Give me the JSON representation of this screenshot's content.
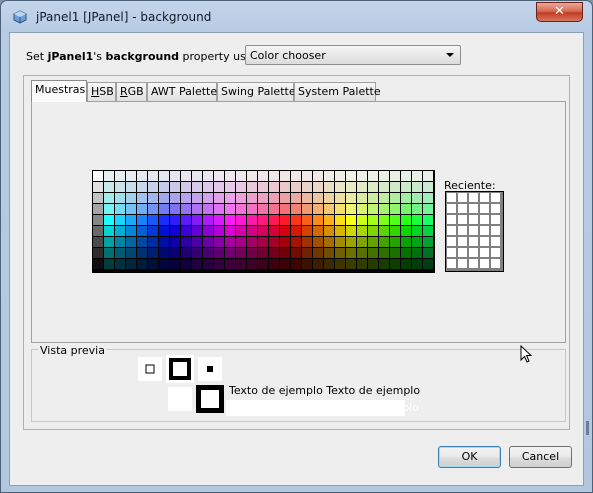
{
  "window": {
    "title": "jPanel1 [JPanel] - background",
    "close_label": "✕"
  },
  "set_property": {
    "prefix": "Set ",
    "component": "jPanel1",
    "middle1": "'s ",
    "property": "background",
    "suffix": " property using:"
  },
  "combo": {
    "value": "Color chooser"
  },
  "tabs": [
    {
      "label": "Muestras",
      "active": true
    },
    {
      "label": "HSB",
      "underline": "H",
      "rest": "SB"
    },
    {
      "label": "RGB",
      "underline": "R",
      "rest": "GB"
    },
    {
      "label": "AWT Palette"
    },
    {
      "label": "Swing Palette"
    },
    {
      "label": "System Palette"
    }
  ],
  "recent": {
    "label": "Reciente:"
  },
  "preview": {
    "title": "Vista previa",
    "sample_text_dark": "Texto de ejemplo  Texto de ejemplo",
    "sample_text_light": "Texto de ejemplo  Texto de ejemplo"
  },
  "buttons": {
    "ok": "OK",
    "cancel": "Cancel"
  }
}
